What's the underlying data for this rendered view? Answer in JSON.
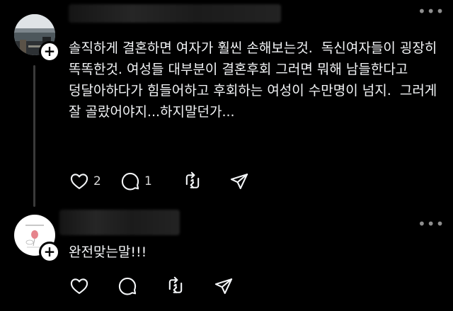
{
  "posts": [
    {
      "text": "솔직하게 결혼하면 여자가 훨씬 손해보는것.  독신여자들이 굉장히 똑똑한것. 여성들 대부분이 결혼후회 그러면 뭐해 남들한다고 덩달아하다가 힘들어하고 후회하는 여성이 수만명이 넘지.  그러게 잘 골랐어야지...하지말던가...",
      "likes": "2",
      "replies": "1",
      "follow_symbol": "+",
      "more_symbol": "•••",
      "avatar_icon": "lakeside-photo-avatar"
    },
    {
      "text": "완전맞는말!!!",
      "likes": "",
      "replies": "",
      "follow_symbol": "+",
      "more_symbol": "•••",
      "avatar_icon": "balloon-drawing-avatar"
    }
  ],
  "icons": {
    "like": "heart-icon",
    "reply": "comment-bubble-icon",
    "repost": "repost-arrows-icon",
    "share": "send-paper-plane-icon"
  },
  "colors": {
    "background": "#000000",
    "text": "#f3f5f7",
    "thread_line": "#3a3a3a"
  }
}
